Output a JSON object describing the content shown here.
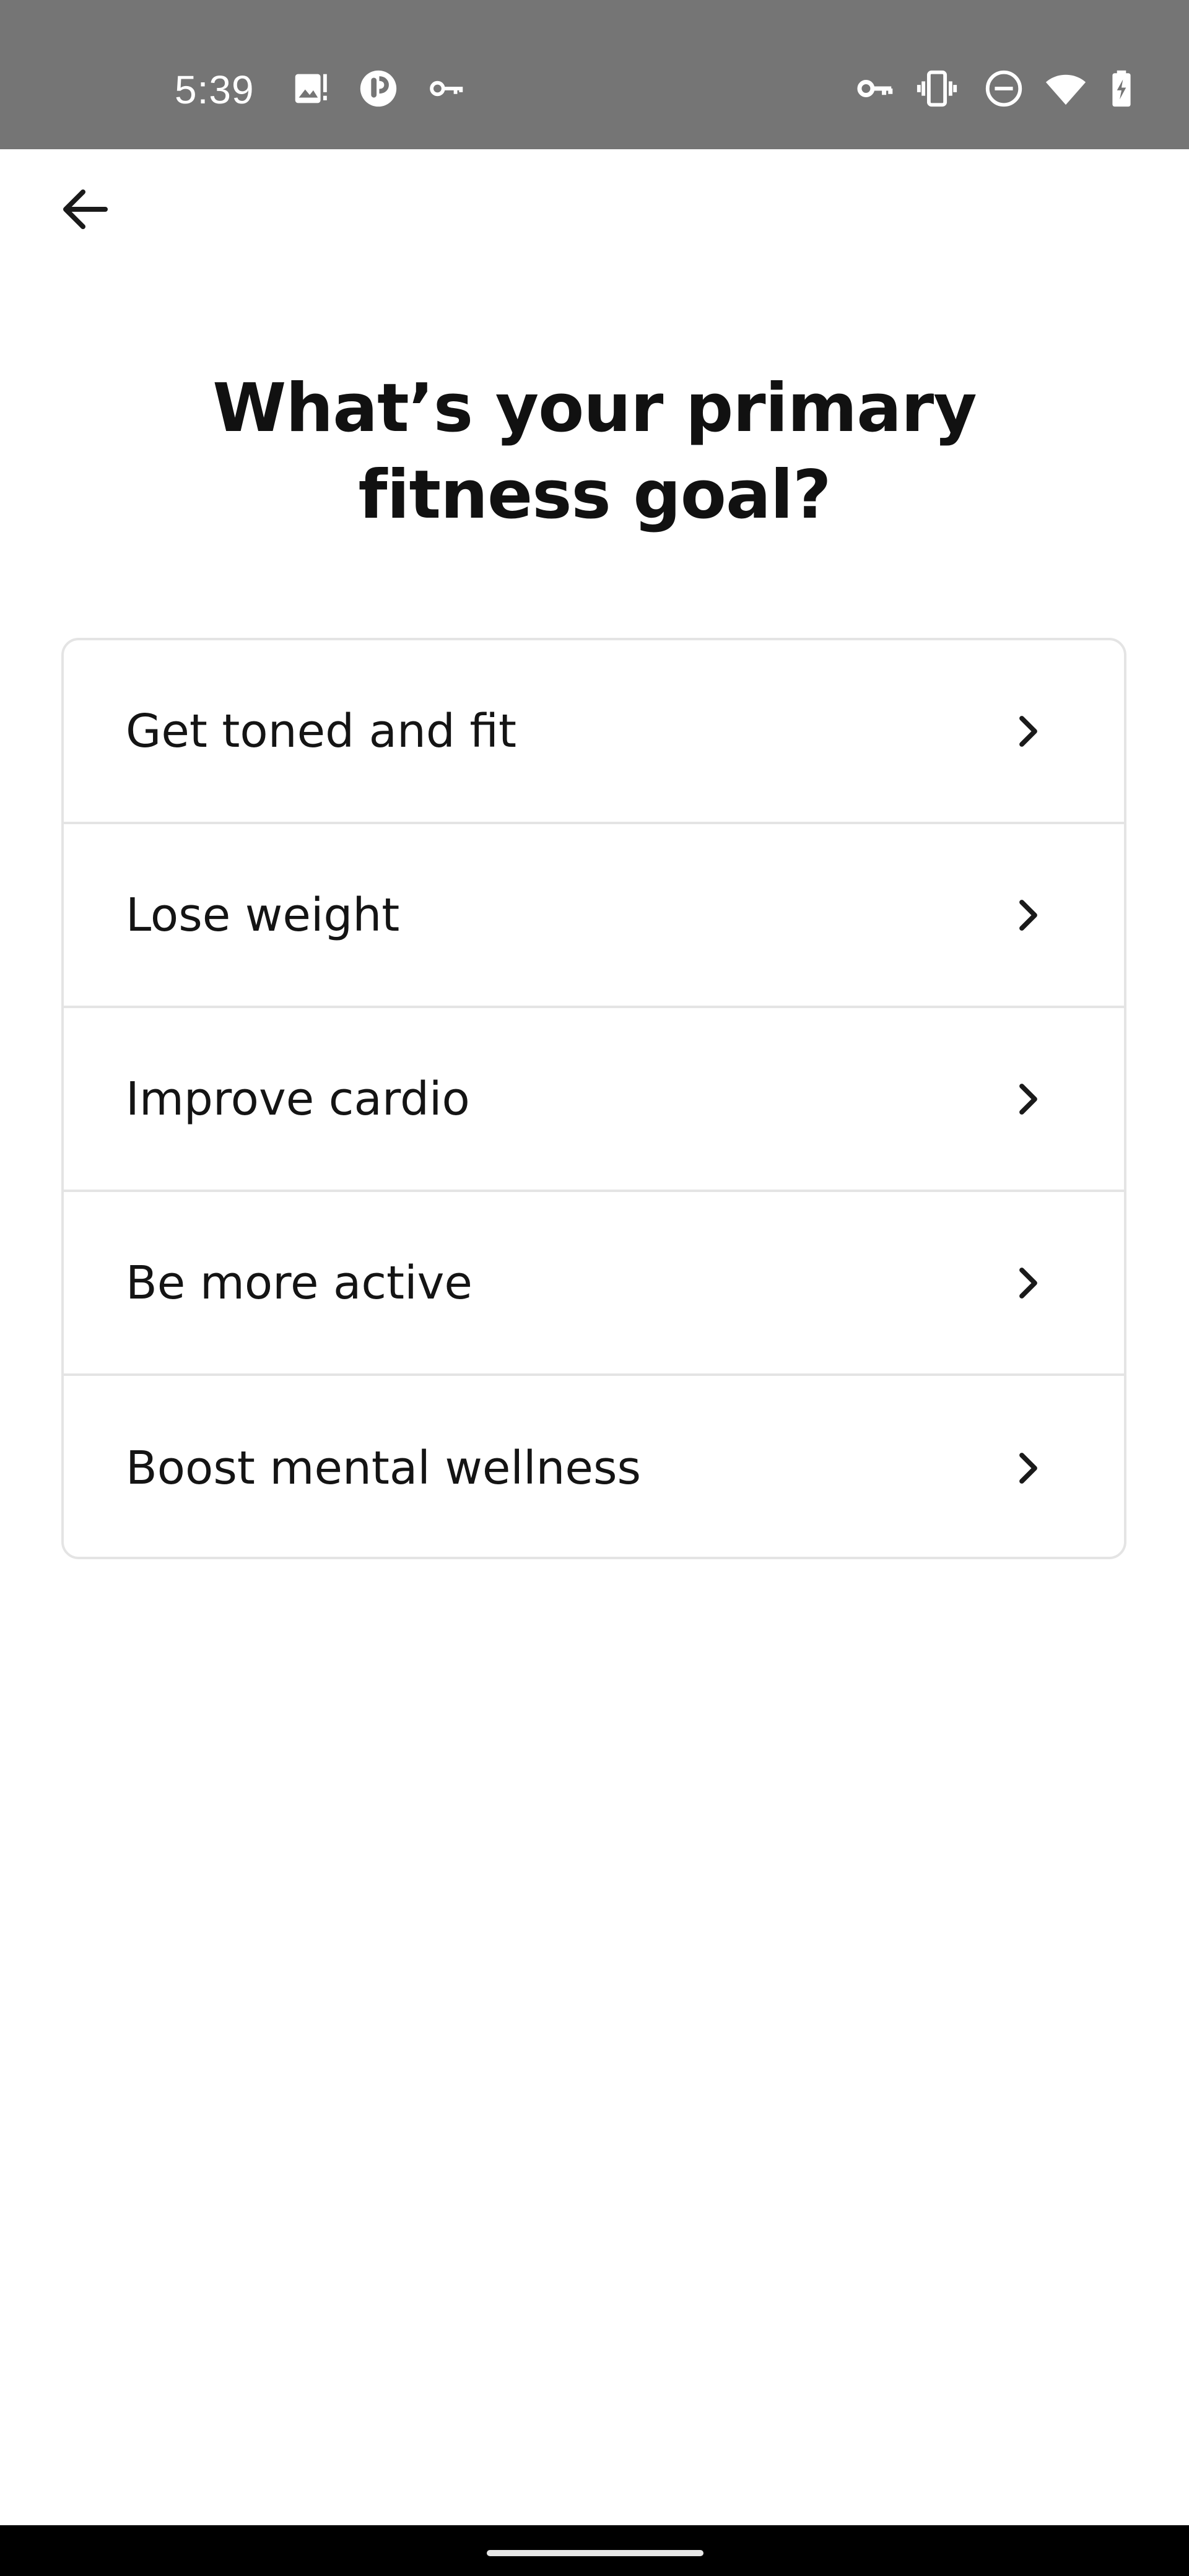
{
  "status_bar": {
    "time": "5:39",
    "left_icons": [
      "image-notification-icon",
      "app-notification-icon",
      "key-icon"
    ],
    "right_icons": [
      "vpn-key-icon",
      "vibrate-icon",
      "do-not-disturb-icon",
      "wifi-icon",
      "battery-charging-icon"
    ],
    "background_color": "#757575"
  },
  "header": {
    "back_icon": "arrow-left-icon"
  },
  "page": {
    "title": "What’s your primary fitness goal?"
  },
  "options": [
    {
      "label": "Get toned and fit"
    },
    {
      "label": "Lose weight"
    },
    {
      "label": "Improve cardio"
    },
    {
      "label": "Be more active"
    },
    {
      "label": "Boost mental wellness"
    }
  ],
  "nav_bar": {
    "background_color": "#000000"
  }
}
